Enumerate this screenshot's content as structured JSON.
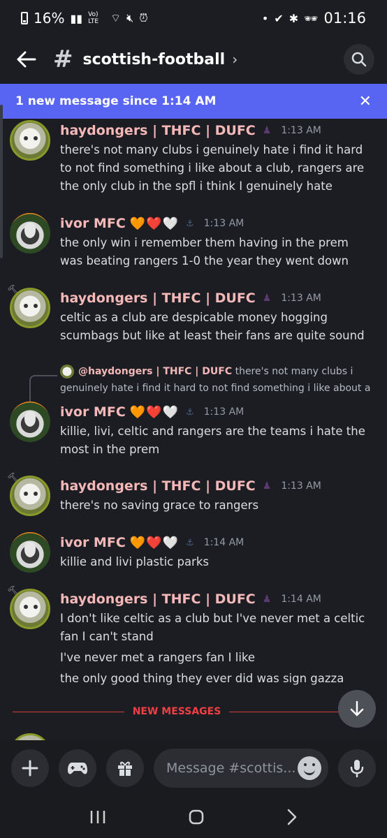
{
  "status_bar": {
    "battery": "16%",
    "network": "Vo) LTE",
    "dot": "•",
    "time": "01:16"
  },
  "header": {
    "channel_name": "scottish-football"
  },
  "banner": {
    "text": "1 new message since 1:14 AM"
  },
  "messages": [
    {
      "author": "haydongers | THFC | DUFC",
      "time": "1:13 AM",
      "lines": [
        "there's not many clubs i genuinely hate i find it hard to not find something i like about a club, rangers are the only club in the spfl i think I genuinely hate"
      ]
    },
    {
      "author": "ivor MFC",
      "hearts": "🧡❤️🤍",
      "time": "1:13 AM",
      "lines": [
        "the only win i remember them having in the prem was beating rangers 1-0 the year they went down"
      ]
    },
    {
      "author": "haydongers | THFC | DUFC",
      "time": "1:13 AM",
      "lines": [
        "celtic as a club are despicable money hogging scumbags but like at least their fans are quite sound"
      ]
    },
    {
      "reply_to": {
        "author": "@haydongers | THFC | DUFC",
        "snippet": "there's not many clubs i genuinely hate i find it hard to not find something i like about a"
      },
      "author": "ivor MFC",
      "hearts": "🧡❤️🤍",
      "time": "1:13 AM",
      "lines": [
        "killie, livi, celtic and rangers are the teams i hate the most in the prem"
      ]
    },
    {
      "author": "haydongers | THFC | DUFC",
      "time": "1:13 AM",
      "lines": [
        "there's no saving grace to rangers"
      ]
    },
    {
      "author": "ivor MFC",
      "hearts": "🧡❤️🤍",
      "time": "1:14 AM",
      "lines": [
        "killie and livi plastic parks"
      ]
    },
    {
      "author": "haydongers | THFC | DUFC",
      "time": "1:14 AM",
      "lines": [
        "I don't like celtic as a club but I've never met a celtic fan I can't stand",
        "I've never met a rangers fan I like",
        "the only good thing they ever did was sign gazza"
      ]
    }
  ],
  "divider": {
    "label": "NEW MESSAGES"
  },
  "input": {
    "placeholder": "Message #scottis..."
  },
  "icons": {
    "back": "back-arrow-icon",
    "search": "search-icon",
    "close": "close-icon",
    "add": "plus-icon",
    "games": "gamepad-icon",
    "gift": "gift-icon",
    "emoji": "emoji-icon",
    "mic": "microphone-icon",
    "jump": "arrow-down-icon"
  },
  "colors": {
    "accent": "#5865f2",
    "username": "#f4b8b8",
    "new_messages": "#f23f43",
    "background": "#1c1d22"
  }
}
